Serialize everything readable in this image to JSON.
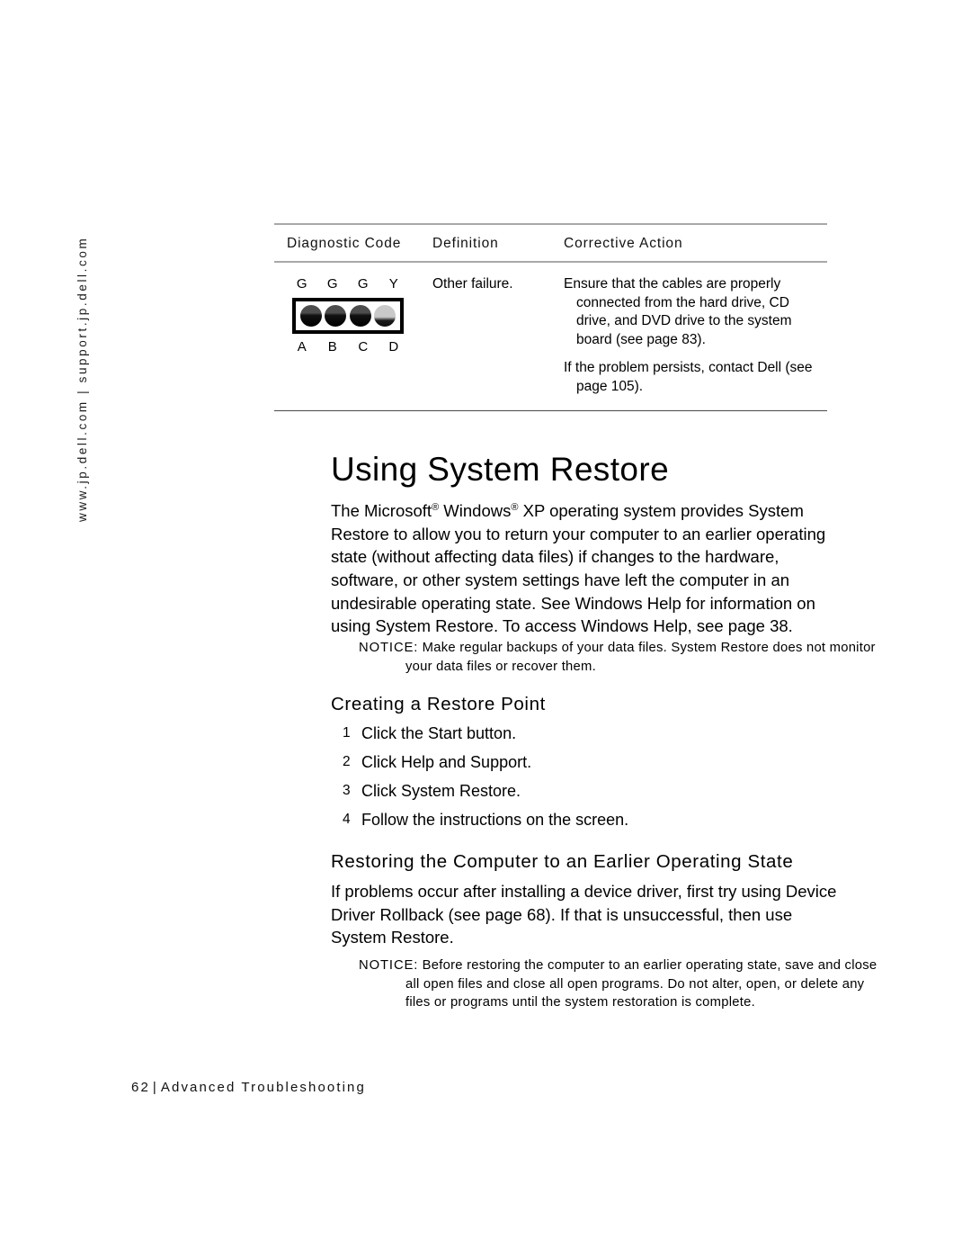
{
  "side_url": "www.jp.dell.com | support.jp.dell.com",
  "table": {
    "headers": {
      "code": "Diagnostic Code",
      "definition": "Definition",
      "action": "Corrective Action"
    },
    "row": {
      "led_top_labels": [
        "G",
        "G",
        "G",
        "Y"
      ],
      "led_bottom_labels": [
        "A",
        "B",
        "C",
        "D"
      ],
      "led_states": [
        "green",
        "green",
        "green",
        "yellow"
      ],
      "definition": "Other failure.",
      "action_paragraphs": [
        "Ensure that the cables are properly connected from the hard drive, CD drive, and DVD drive to the system board (see page 83).",
        "If the problem persists, contact Dell (see page 105)."
      ]
    }
  },
  "main": {
    "heading": "Using System Restore",
    "intro_parts": {
      "p1": "The Microsoft",
      "reg1": "®",
      "p2": " Windows",
      "reg2": "®",
      "p3": " XP operating system provides System Restore to allow you to return your computer to an earlier operating state (without affecting data files) if changes to the hardware, software, or other system settings have left the computer in an undesirable operating state. See Windows Help for information on using System Restore. To access Windows Help, see page 38."
    },
    "notice_1": {
      "label": "NOTICE:",
      "text": " Make regular backups of your data files. System Restore does not monitor your data files or recover them."
    },
    "subheading_1": "Creating a Restore Point",
    "steps": [
      {
        "num": "1",
        "text": "Click the Start button."
      },
      {
        "num": "2",
        "text": "Click Help and Support."
      },
      {
        "num": "3",
        "text": "Click System Restore."
      },
      {
        "num": "4",
        "text": "Follow the instructions on the screen."
      }
    ],
    "subheading_2": "Restoring the Computer to an Earlier Operating State",
    "body_paragraph": "If problems occur after installing a device driver, first try using Device Driver Rollback (see page 68). If that is unsuccessful, then use System Restore.",
    "notice_2": {
      "label": "NOTICE:",
      "text": " Before restoring the computer to an earlier operating state, save and close all open files and close all open programs. Do not alter, open, or delete any files or programs until the system restoration is complete."
    }
  },
  "footer": {
    "page_number": "62",
    "separator": "|",
    "section": "Advanced Troubleshooting"
  }
}
